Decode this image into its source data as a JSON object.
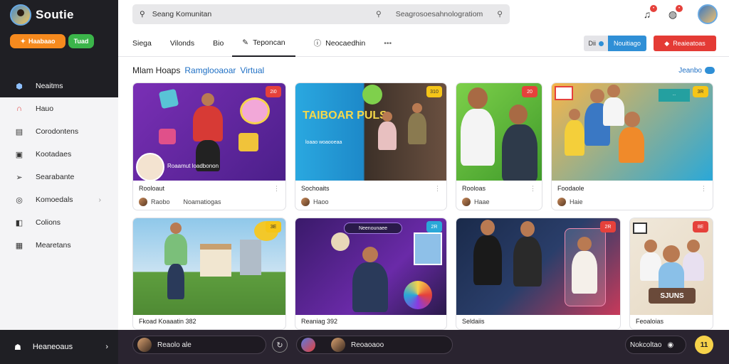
{
  "app": {
    "name": "Soutie"
  },
  "sidebar": {
    "primary_btn": "Haabaao",
    "secondary_btn": "Tuad",
    "items": [
      {
        "label": "Neaitms",
        "icon": "shield-icon"
      },
      {
        "label": "Hauo",
        "icon": "home-icon"
      },
      {
        "label": "Corodontens",
        "icon": "calendar-icon"
      },
      {
        "label": "Kootadaes",
        "icon": "folder-icon"
      },
      {
        "label": "Searabante",
        "icon": "share-icon"
      },
      {
        "label": "Komoedals",
        "icon": "compass-icon"
      },
      {
        "label": "Colions",
        "icon": "bookmark-icon"
      },
      {
        "label": "Mearetans",
        "icon": "list-icon"
      }
    ],
    "bottom": {
      "label": "Heaneoaus",
      "icon": "user-icon"
    }
  },
  "search": {
    "placeholder": "Seang Komunitan",
    "secondary": "Seagrosoesahnologratiom"
  },
  "tabs": [
    {
      "label": "Siega"
    },
    {
      "label": "Vilonds"
    },
    {
      "label": "Bio"
    },
    {
      "label": "Teponcan",
      "icon": "pencil-icon"
    },
    {
      "label": "Neocaedhin",
      "icon": "info-icon"
    },
    {
      "label": "•••"
    }
  ],
  "actions": {
    "seg_a": "Dii",
    "seg_b": "Nouitiago",
    "red_btn": "Reaieatoas"
  },
  "section": {
    "title": "Mlam Hoaps",
    "subtitle1": "Ramglooaoar",
    "subtitle2": "Virtual",
    "right_link": "Jeanbo"
  },
  "cards": [
    {
      "title": "Rooloaut",
      "overlay": "Roaamut loadbonon",
      "author": "Raobo",
      "author2": "Noamatiogas",
      "tag": "2i0"
    },
    {
      "title": "Sochoaits",
      "author": "Haoo",
      "banner": "TAIBOAR PULS",
      "banner_sub": "loaao woaooeaa",
      "tag": "310"
    },
    {
      "title": "Rooloas",
      "author": "Haae",
      "tag": "20"
    },
    {
      "title": "Foodaole",
      "author": "Haie",
      "tag": "3R"
    },
    {
      "title": "Fkoad Koaaatin 382",
      "tag": "3E"
    },
    {
      "title": "Reaniag 392",
      "overlay": "Neenounaee",
      "tag": "2R"
    },
    {
      "title": "Seldaiis",
      "tag": "2R"
    },
    {
      "title": "Feoaloias",
      "overlay": "SJUNS",
      "tag": "8E"
    }
  ],
  "bottombar": {
    "left_label": "Reaolo ale",
    "mid_label": "Reoaoaoo",
    "right_label": "Nokcoltao",
    "right_count": "11"
  }
}
